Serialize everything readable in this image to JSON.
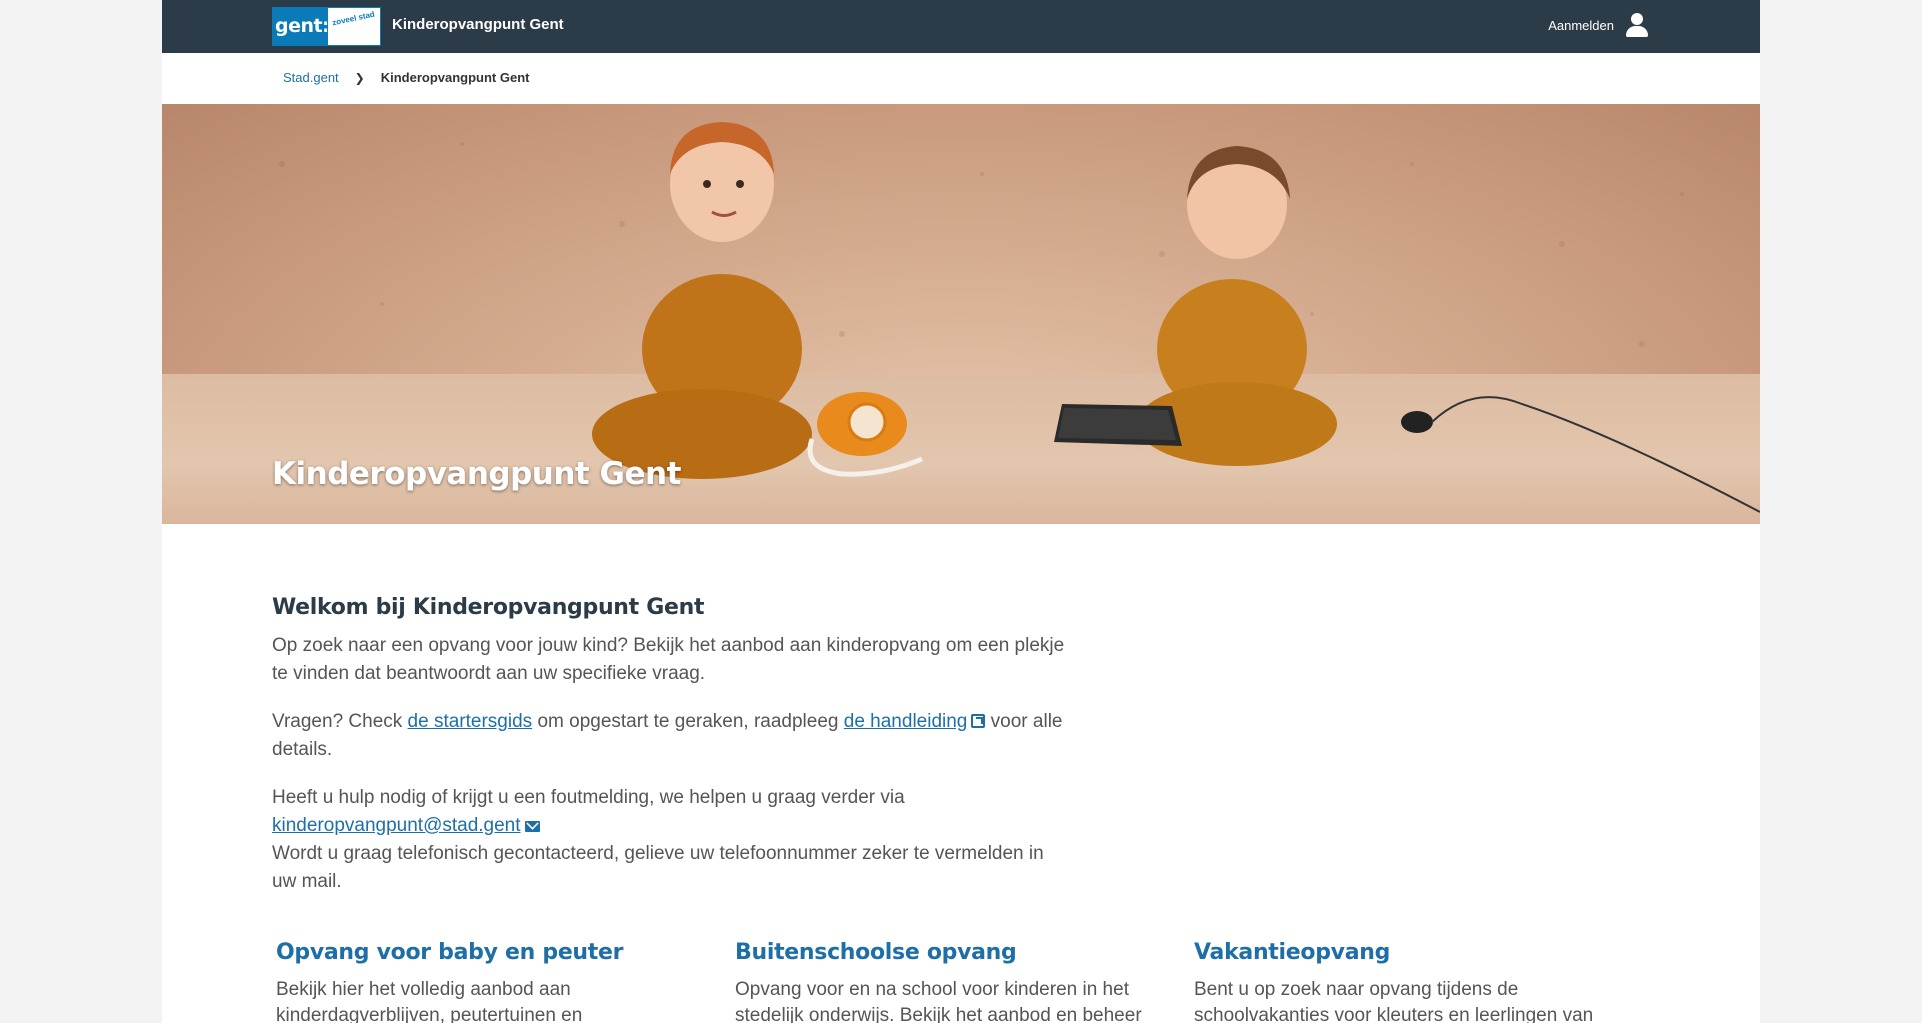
{
  "header": {
    "logo_text": "gent:",
    "logo_tagline": "zoveel stad",
    "site_title": "Kinderopvangpunt Gent",
    "login_label": "Aanmelden",
    "login_icon": "user-icon"
  },
  "breadcrumb": {
    "items": [
      {
        "label": "Stad.gent"
      },
      {
        "label": "Kinderopvangpunt Gent"
      }
    ],
    "separator_icon": "chevron-right-icon"
  },
  "hero": {
    "title": "Kinderopvangpunt Gent"
  },
  "intro": {
    "title": "Welkom bij Kinderopvangpunt Gent",
    "p1": "Op zoek naar een opvang voor jouw kind? Bekijk het aanbod aan kinderopvang om een plekje te vinden dat beantwoordt aan uw specifieke vraag.",
    "p2_before": "Vragen? Check ",
    "p2_link1": "de startersgids",
    "p2_middle": " om opgestart te geraken, raadpleeg ",
    "p2_link2": "de handleiding",
    "p2_after": " voor alle details.",
    "p3_line1": "Heeft u hulp nodig of krijgt u een foutmelding, we helpen u graag verder via",
    "p3_email": "kinderopvangpunt@stad.gent",
    "p3_line2": "Wordt u graag telefonisch gecontacteerd, gelieve uw telefoonnummer zeker te vermelden in uw mail."
  },
  "cards": [
    {
      "title": "Opvang voor baby en peuter",
      "text": "Bekijk hier het volledig aanbod aan kinderdagverblijven, peutertuinen en"
    },
    {
      "title": "Buitenschoolse opvang",
      "text": "Opvang voor en na school voor kinderen in het stedelijk onderwijs. Bekijk het aanbod en beheer"
    },
    {
      "title": "Vakantieopvang",
      "text": "Bent u op zoek naar opvang tijdens de schoolvakanties voor kleuters en leerlingen van"
    }
  ],
  "colors": {
    "header_bg": "#2b3b47",
    "brand_blue": "#0a7ab9",
    "link": "#1e6fa8"
  }
}
